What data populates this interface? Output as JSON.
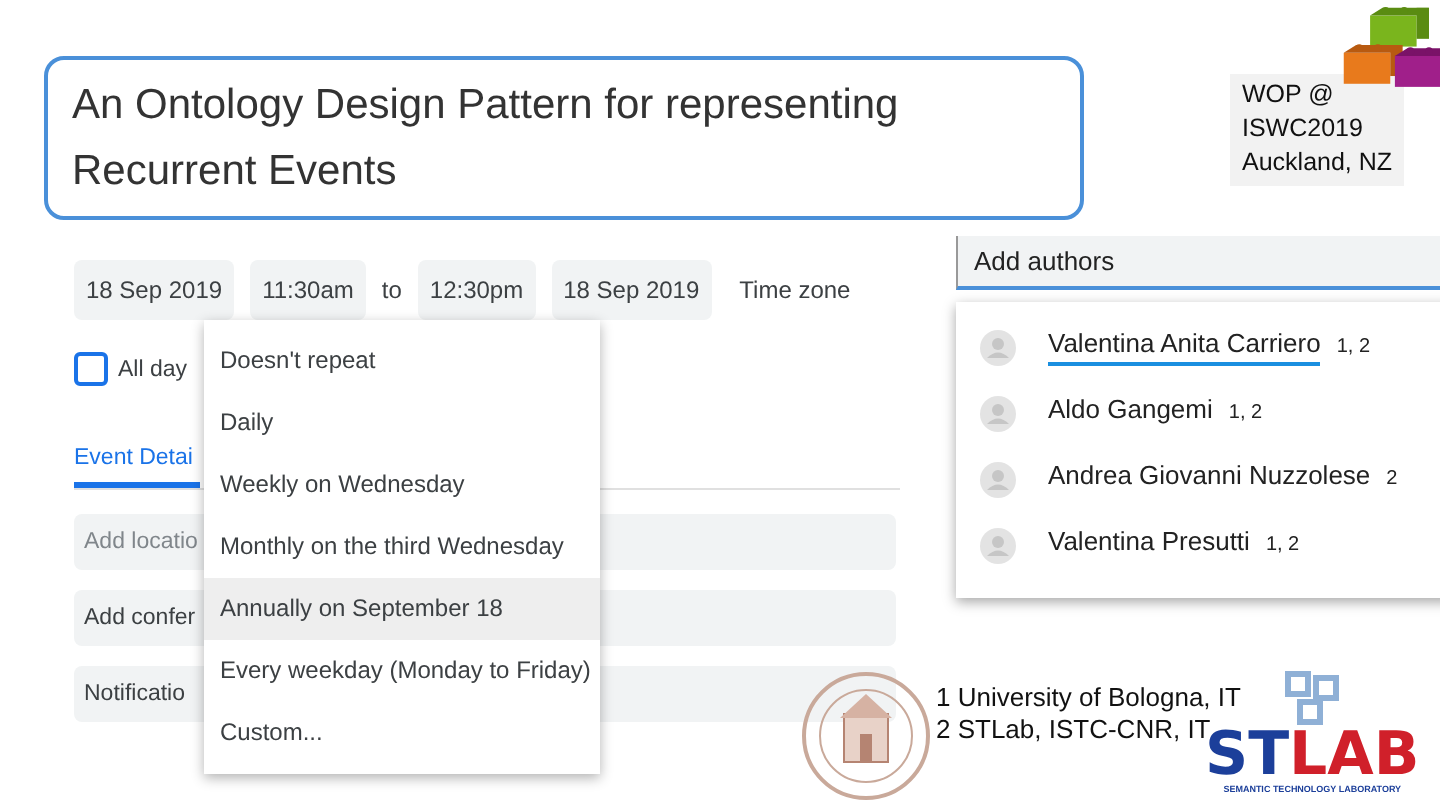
{
  "title": "An Ontology Design Pattern for representing Recurrent Events",
  "venue": [
    "WOP @",
    "ISWC2019",
    "Auckland, NZ"
  ],
  "event_form": {
    "start_date": "18 Sep 2019",
    "start_time": "11:30am",
    "separator": "to",
    "end_time": "12:30pm",
    "end_date": "18 Sep 2019",
    "time_zone": "Time zone",
    "all_day": {
      "label": "All day",
      "checked": false
    },
    "tabs": [
      {
        "label": "Event Detai",
        "selected": true
      }
    ],
    "rows": [
      "Add locatio",
      "Add confer",
      "Notificatio"
    ]
  },
  "repeat_menu": [
    {
      "label": "Doesn't repeat",
      "selected": false
    },
    {
      "label": "Daily",
      "selected": false
    },
    {
      "label": "Weekly on Wednesday",
      "selected": false
    },
    {
      "label": "Monthly on the third Wednesday",
      "selected": false
    },
    {
      "label": "Annually on September 18",
      "selected": true
    },
    {
      "label": "Every weekday (Monday to Friday)",
      "selected": false
    },
    {
      "label": "Custom...",
      "selected": false
    }
  ],
  "authors_field": {
    "placeholder": "Add authors"
  },
  "authors": [
    {
      "name": "Valentina Anita Carriero",
      "affiliations": "1, 2",
      "selected": true
    },
    {
      "name": "Aldo Gangemi",
      "affiliations": "1, 2",
      "selected": false
    },
    {
      "name": "Andrea Giovanni Nuzzolese",
      "affiliations": "2",
      "selected": false
    },
    {
      "name": "Valentina Presutti",
      "affiliations": "1, 2",
      "selected": false
    }
  ],
  "affiliations": [
    "1 University of Bologna, IT",
    "2 STLab, ISTC-CNR, IT"
  ],
  "lab_logo": {
    "left": "ST",
    "right": "LAB",
    "tagline": "SEMANTIC TECHNOLOGY LABORATORY"
  }
}
